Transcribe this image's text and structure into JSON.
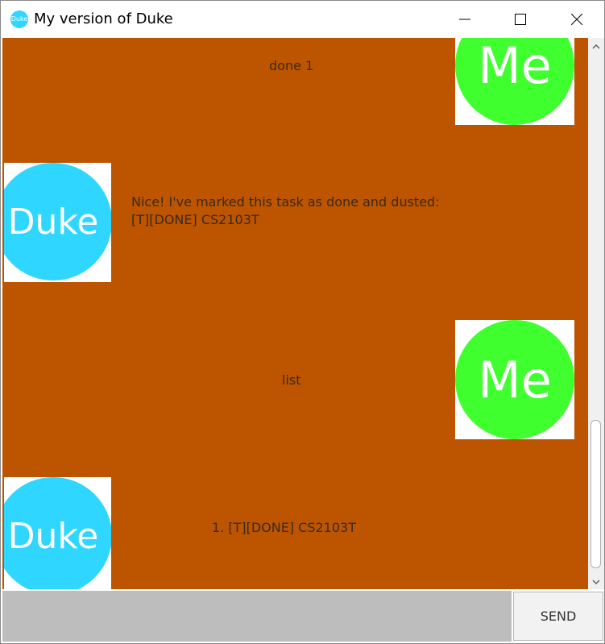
{
  "window": {
    "title": "My version of Duke",
    "icon_label": "Duke"
  },
  "messages": [
    {
      "sender": "user",
      "text": "done 1",
      "avatar_label": "Me"
    },
    {
      "sender": "duke",
      "text": "Nice! I've marked this task as done and dusted:\n[T][DONE] CS2103T",
      "avatar_label": "Duke"
    },
    {
      "sender": "user",
      "text": "list",
      "avatar_label": "Me"
    },
    {
      "sender": "duke",
      "text": "1. [T][DONE] CS2103T",
      "avatar_label": "Duke"
    }
  ],
  "input": {
    "value": "",
    "placeholder": ""
  },
  "send_label": "SEND",
  "colors": {
    "chat_background": "#bd5400",
    "duke_avatar": "#2fd6ff",
    "me_avatar": "#40ff2f",
    "input_bar": "#bdbdbd"
  }
}
